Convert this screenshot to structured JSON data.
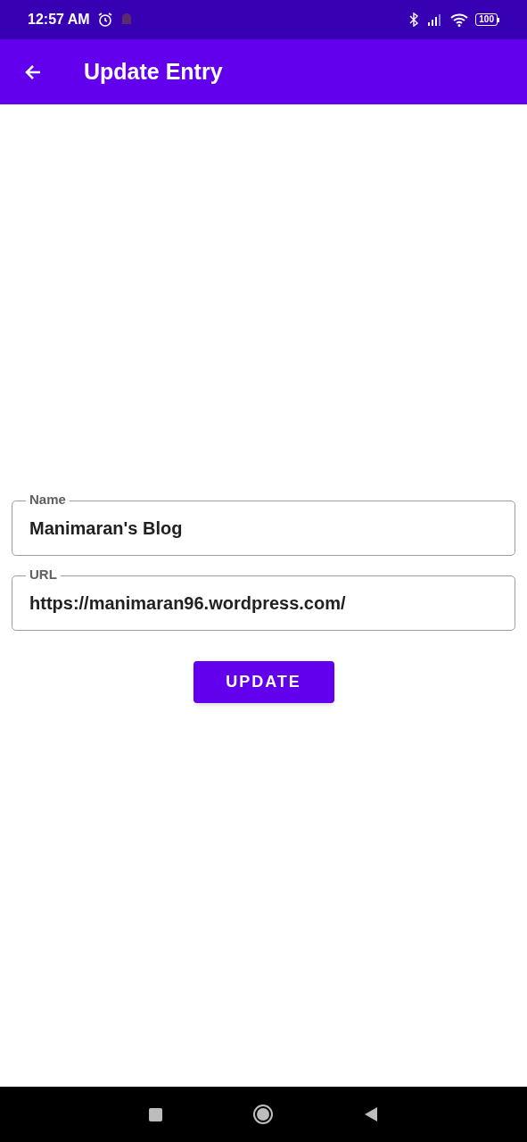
{
  "status_bar": {
    "time": "12:57 AM",
    "battery": "100"
  },
  "app_bar": {
    "title": "Update Entry"
  },
  "fields": [
    {
      "label": "Name",
      "value": "Manimaran's Blog"
    },
    {
      "label": "URL",
      "value": "https://manimaran96.wordpress.com/"
    }
  ],
  "button": {
    "label": "UPDATE"
  }
}
